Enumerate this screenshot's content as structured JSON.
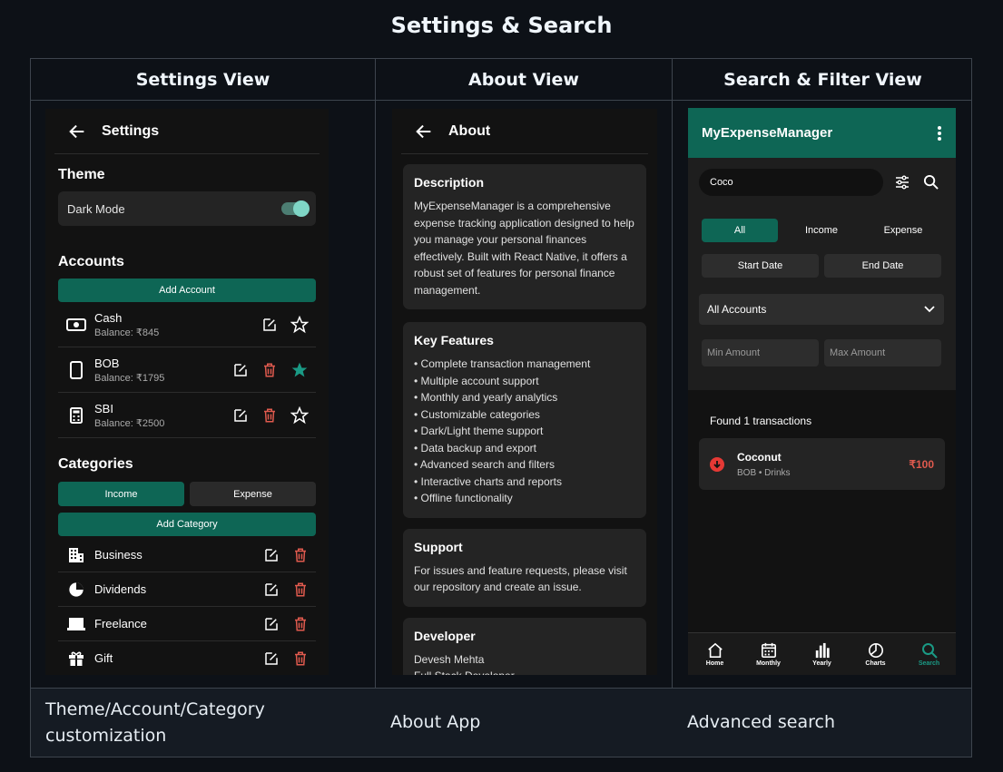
{
  "page_title": "Settings & Search",
  "columns": [
    "Settings View",
    "About View",
    "Search & Filter View"
  ],
  "captions": [
    "Theme/Account/Category customization",
    "About App",
    "Advanced search"
  ],
  "settings": {
    "title": "Settings",
    "theme_heading": "Theme",
    "dark_mode_label": "Dark Mode",
    "accounts_heading": "Accounts",
    "add_account": "Add Account",
    "accounts": [
      {
        "name": "Cash",
        "balance": "Balance: ₹845",
        "icon": "cash-icon",
        "favorite": false,
        "deletable": false
      },
      {
        "name": "BOB",
        "balance": "Balance: ₹1795",
        "icon": "phone-icon",
        "favorite": true,
        "deletable": true
      },
      {
        "name": "SBI",
        "balance": "Balance: ₹2500",
        "icon": "calculator-icon",
        "favorite": false,
        "deletable": true
      }
    ],
    "categories_heading": "Categories",
    "cat_tabs": [
      "Income",
      "Expense"
    ],
    "add_category": "Add Category",
    "categories": [
      {
        "name": "Business",
        "icon": "building-icon"
      },
      {
        "name": "Dividends",
        "icon": "pie-icon"
      },
      {
        "name": "Freelance",
        "icon": "laptop-icon"
      },
      {
        "name": "Gift",
        "icon": "gift-icon"
      }
    ]
  },
  "about": {
    "title": "About",
    "description_heading": "Description",
    "description": "MyExpenseManager is a comprehensive expense tracking application designed to help you manage your personal finances effectively. Built with React Native, it offers a robust set of features for personal finance management.",
    "features_heading": "Key Features",
    "features": [
      "• Complete transaction management",
      "• Multiple account support",
      "• Monthly and yearly analytics",
      "• Customizable categories",
      "• Dark/Light theme support",
      "• Data backup and export",
      "• Advanced search and filters",
      "• Interactive charts and reports",
      "• Offline functionality"
    ],
    "support_heading": "Support",
    "support_text": "For issues and feature requests, please visit our repository and create an issue.",
    "developer_heading": "Developer",
    "developer_name": "Devesh Mehta",
    "developer_role": "Full Stack Developer"
  },
  "search": {
    "app_title": "MyExpenseManager",
    "query": "Coco",
    "type_tabs": [
      "All",
      "Income",
      "Expense"
    ],
    "start_date": "Start Date",
    "end_date": "End Date",
    "account_select": "All Accounts",
    "min_amount": "Min Amount",
    "max_amount": "Max Amount",
    "result_count": "Found 1 transactions",
    "result": {
      "name": "Coconut",
      "meta": "BOB • Drinks",
      "amount": "₹100"
    },
    "nav": [
      {
        "label": "Home",
        "icon": "home-icon"
      },
      {
        "label": "Monthly",
        "icon": "calendar-icon"
      },
      {
        "label": "Yearly",
        "icon": "bar-chart-icon"
      },
      {
        "label": "Charts",
        "icon": "pie-chart-icon"
      },
      {
        "label": "Search",
        "icon": "search-icon"
      }
    ]
  },
  "colors": {
    "accent": "#0e6655",
    "danger": "#e05a4e",
    "background": "#0d1117"
  }
}
